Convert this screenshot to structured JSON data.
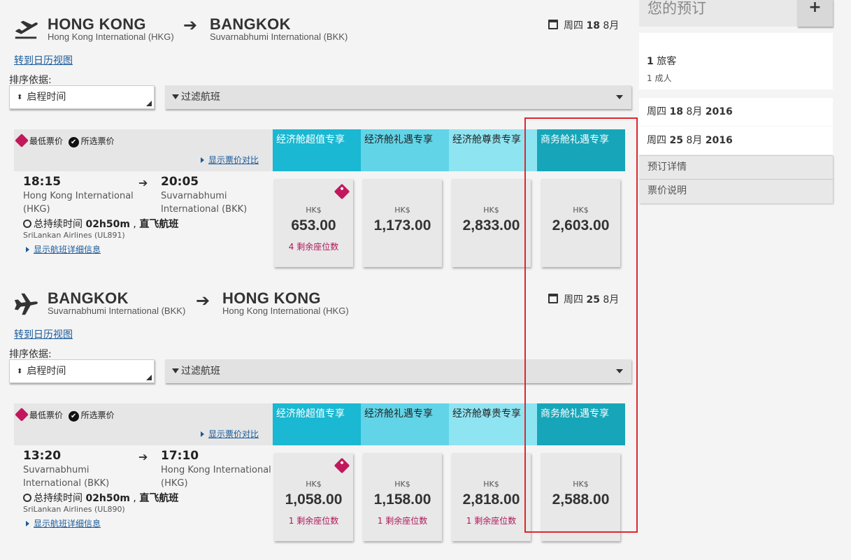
{
  "outbound": {
    "from_city": "HONG KONG",
    "from_airport": "Hong Kong International (HKG)",
    "to_city": "BANGKOK",
    "to_airport": "Suvarnabhumi International (BKK)",
    "date_weekday": "周四",
    "date_rest_bold": "18",
    "date_month": "8月",
    "calendar_link": "转到日历视图",
    "sort_label": "排序依据:",
    "sort_value": "启程时间",
    "filter_label": "过滤航班",
    "legend_lowest": "最低票价",
    "legend_selected": "所选票价",
    "compare_link": "显示票价对比",
    "fare_headers": [
      "经济舱超值专享",
      "经济舱礼遇专享",
      "经济舱尊贵专享",
      "商务舱礼遇专享"
    ],
    "flight": {
      "dep_time": "18:15",
      "dep_airport": "Hong Kong International (HKG)",
      "arr_time": "20:05",
      "arr_airport": "Suvarnabhumi International (BKK)",
      "duration_label": "总持续时间",
      "duration": "02h50m",
      "direct": "直飞航班",
      "airline": "SriLankan Airlines (UL891)",
      "detail_link": "显示航班详细信息"
    },
    "prices": [
      {
        "currency": "HK$",
        "amount": "653.00",
        "seats": "4 剩余座位数",
        "lowest": true
      },
      {
        "currency": "HK$",
        "amount": "1,173.00",
        "seats": "",
        "lowest": false
      },
      {
        "currency": "HK$",
        "amount": "2,833.00",
        "seats": "",
        "lowest": false
      },
      {
        "currency": "HK$",
        "amount": "2,603.00",
        "seats": "",
        "lowest": false
      }
    ]
  },
  "inbound": {
    "from_city": "BANGKOK",
    "from_airport": "Suvarnabhumi International (BKK)",
    "to_city": "HONG KONG",
    "to_airport": "Hong Kong International (HKG)",
    "date_weekday": "周四",
    "date_rest_bold": "25",
    "date_month": "8月",
    "calendar_link": "转到日历视图",
    "sort_label": "排序依据:",
    "sort_value": "启程时间",
    "filter_label": "过滤航班",
    "legend_lowest": "最低票价",
    "legend_selected": "所选票价",
    "compare_link": "显示票价对比",
    "fare_headers": [
      "经济舱超值专享",
      "经济舱礼遇专享",
      "经济舱尊贵专享",
      "商务舱礼遇专享"
    ],
    "flight": {
      "dep_time": "13:20",
      "dep_airport": "Suvarnabhumi International (BKK)",
      "arr_time": "17:10",
      "arr_airport": "Hong Kong International (HKG)",
      "duration_label": "总持续时间",
      "duration": "02h50m",
      "direct": "直飞航班",
      "airline": "SriLankan Airlines (UL890)",
      "detail_link": "显示航班详细信息"
    },
    "prices": [
      {
        "currency": "HK$",
        "amount": "1,058.00",
        "seats": "1 剩余座位数",
        "lowest": true
      },
      {
        "currency": "HK$",
        "amount": "1,158.00",
        "seats": "1 剩余座位数",
        "lowest": false
      },
      {
        "currency": "HK$",
        "amount": "2,818.00",
        "seats": "1 剩余座位数",
        "lowest": false
      },
      {
        "currency": "HK$",
        "amount": "2,588.00",
        "seats": "",
        "lowest": false
      }
    ]
  },
  "sidebar": {
    "title": "您的预订",
    "plus": "+",
    "travellers_count": "1",
    "travellers_label": "旅客",
    "adults": "1 成人",
    "date1_weekday": "周四",
    "date1_day": "18",
    "date1_month": "8月",
    "date1_year": "2016",
    "date2_weekday": "周四",
    "date2_day": "25",
    "date2_month": "8月",
    "date2_year": "2016",
    "booking_details": "预订详情",
    "fare_notes": "票价说明"
  },
  "colors": {
    "fare_header_1": "#1ab8d2",
    "fare_header_2": "#61d4e8",
    "fare_header_3": "#8fe4f2",
    "fare_header_4": "#17a6b9",
    "lowest_tag": "#c2185b",
    "highlight_box": "#e0262b"
  }
}
